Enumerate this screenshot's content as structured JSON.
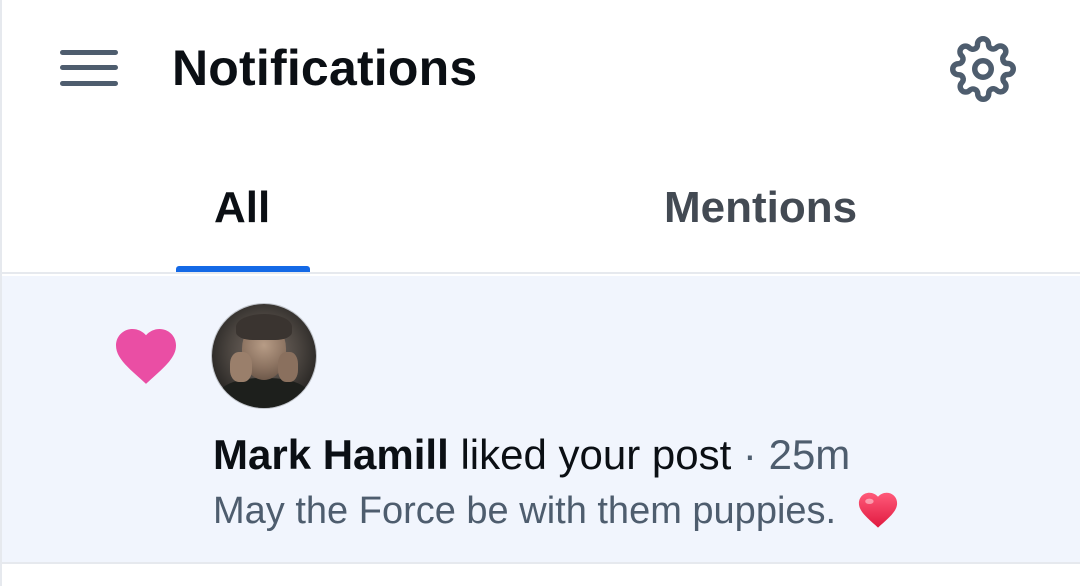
{
  "header": {
    "title": "Notifications",
    "menu_icon": "hamburger-menu-icon",
    "settings_icon": "gear-icon"
  },
  "tabs": [
    {
      "label": "All",
      "selected": true
    },
    {
      "label": "Mentions",
      "selected": false
    }
  ],
  "notifications": [
    {
      "type_icon": "heart-icon",
      "author": "Mark Hamill",
      "action": "liked your post",
      "separator": "·",
      "time": "25m",
      "post_text": "May the Force be with them puppies.",
      "post_emoji": "red-heart-emoji"
    }
  ],
  "colors": {
    "accent": "#1469e6",
    "like_heart": "#ea4ea4",
    "unread_background": "#f1f5fd",
    "icon_gray": "#4e5d6e",
    "emoji_heart": "#e8304a"
  }
}
